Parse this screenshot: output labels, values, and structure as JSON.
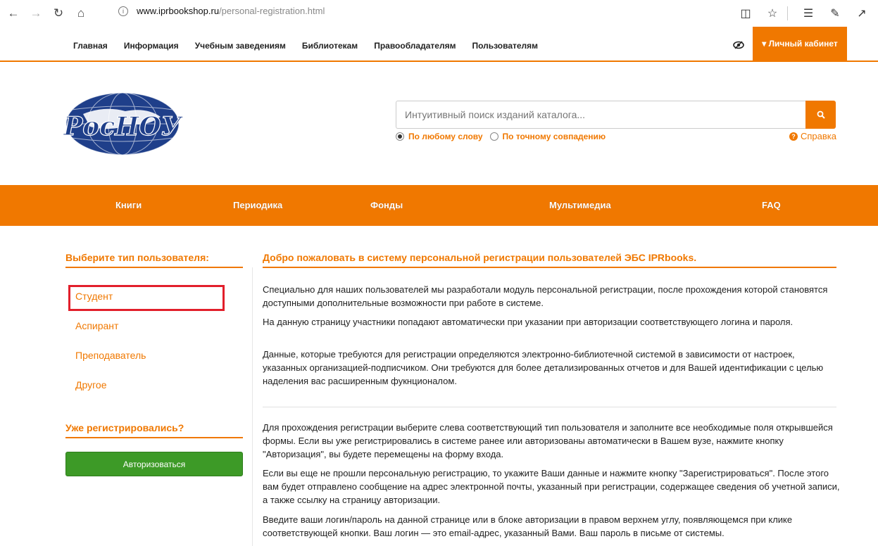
{
  "browser": {
    "url_host": "www.iprbookshop.ru",
    "url_path": "/personal-registration.html"
  },
  "topnav": {
    "items": [
      "Главная",
      "Информация",
      "Учебным заведениям",
      "Библиотекам",
      "Правообладателям",
      "Пользователям"
    ],
    "cabinet_label": "▾ Личный кабинет"
  },
  "search": {
    "placeholder": "Интуитивный поиск изданий каталога...",
    "option_any": "По любому слову",
    "option_exact": "По точному совпадению",
    "help_label": "Справка"
  },
  "mainnav": {
    "items": [
      "Книги",
      "Периодика",
      "Фонды",
      "Мультимедиа",
      "FAQ"
    ]
  },
  "sidebar": {
    "heading": "Выберите тип пользователя:",
    "items": [
      "Студент",
      "Аспирант",
      "Преподаватель",
      "Другое"
    ],
    "registered_heading": "Уже регистрировались?",
    "auth_button": "Авторизоваться"
  },
  "content": {
    "title": "Добро пожаловать в систему персональной регистрации пользователей ЭБС IPRbooks.",
    "paragraphs": [
      "Специально для наших пользователей мы разработали модуль персональной регистрации, после прохождения которой становятся доступными дополнительные возможности при работе в системе.",
      "На данную страницу участники попадают автоматически при указании при авторизации соответствующего логина и пароля.",
      "Данные, которые требуются для регистрации определяются электронно-библиотечной системой в зависимости от настроек, указанных организацией-подписчиком. Они требуются для более детализированных отчетов и для Вашей идентификации с целью наделения вас расширенным фукнционалом.",
      "Для прохождения регистрации выберите слева соответствующий тип пользователя и заполните все необходимые поля открывшейся формы. Если вы уже регистрировались в системе ранее или авторизованы автоматически в Вашем вузе, нажмите кнопку \"Авторизация\", вы будете перемещены на форму входа.",
      "Если вы еще не прошли персональную регистрацию, то укажите Ваши данные и нажмите кнопку \"Зарегистрироваться\". После этого вам будет отправлено сообщение на адрес электронной почты, указанный при регистрации, содержащее сведения об учетной записи, а также ссылку на страницу авторизации.",
      "Введите ваши логин/пароль на данной странице или в блоке авторизации в правом верхнем углу, появляющемся при клике соответствующей кнопки. Ваш логин — это email-адрес, указанный Вами. Ваш пароль в письме от системы."
    ]
  },
  "colors": {
    "accent": "#f07800",
    "auth_green": "#3d9a27",
    "highlight_red": "#e21f2b",
    "logo_blue": "#1f3f8a"
  }
}
